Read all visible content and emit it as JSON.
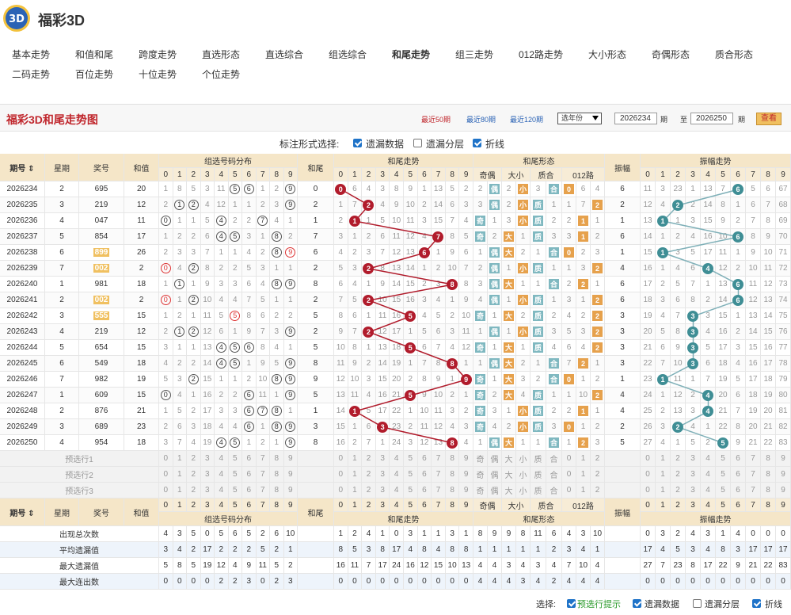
{
  "site": {
    "title": "福彩3D",
    "logo_icon": "fucai-3d-logo"
  },
  "nav": {
    "row1": [
      "基本走势",
      "和值和尾",
      "跨度走势",
      "直选形态",
      "直选综合",
      "组选综合",
      "和尾走势",
      "组三走势",
      "012路走势",
      "大小形态",
      "奇偶形态",
      "质合形态"
    ],
    "row2": [
      "二码走势",
      "百位走势",
      "十位走势",
      "个位走势"
    ],
    "active": "和尾走势"
  },
  "panel": {
    "title": "福彩3D和尾走势图",
    "ranges": [
      "最近50期",
      "最近80期",
      "最近120期"
    ],
    "active_range": "最近50期",
    "year_select": "选年份",
    "from": "2026234",
    "to": "2026250",
    "unit": "期",
    "to_label": "至",
    "query": "查看"
  },
  "markbar": {
    "label": "标注形式选择:",
    "options": [
      {
        "label": "遗漏数据",
        "checked": true
      },
      {
        "label": "遗漏分层",
        "checked": false
      },
      {
        "label": "折线",
        "checked": true
      }
    ]
  },
  "headers": {
    "issue": "期号",
    "week": "星期",
    "prize": "奖号",
    "sum": "和值",
    "tail": "和尾",
    "g_group": "组选号码分布",
    "g_tail": "和尾走势",
    "g_form": "和尾形态",
    "g_amp": "振幅",
    "g_amptrend": "振幅走势",
    "digits": [
      "0",
      "1",
      "2",
      "3",
      "4",
      "5",
      "6",
      "7",
      "8",
      "9"
    ],
    "form_groups": [
      "奇偶",
      "大小",
      "质合",
      "012路"
    ],
    "form_sub": [
      "奇",
      "偶",
      "大",
      "小",
      "质",
      "合",
      "0",
      "1",
      "2"
    ]
  },
  "rows": [
    {
      "issue": "2026234",
      "week": "2",
      "prize": "695",
      "sum": "20",
      "sumhl": false,
      "tail": "0",
      "amp": "6",
      "grp": [
        "1",
        "8",
        "5",
        "3",
        "11",
        "(5)",
        "(6)",
        "1",
        "2",
        "(9)"
      ],
      "tr": [
        "B0",
        "6",
        "4",
        "3",
        "8",
        "9",
        "1",
        "13",
        "5",
        "2"
      ],
      "form": [
        "2",
        "T偶",
        "2",
        "O小",
        "3",
        "T合",
        "O0",
        "6",
        "4"
      ],
      "at": [
        "11",
        "3",
        "23",
        "1",
        "13",
        "7",
        "B6",
        "5",
        "6",
        "67"
      ]
    },
    {
      "issue": "2026235",
      "week": "3",
      "prize": "219",
      "sum": "12",
      "sumhl": false,
      "tail": "2",
      "amp": "2",
      "grp": [
        "2",
        "(1)",
        "(2)",
        "4",
        "12",
        "1",
        "1",
        "2",
        "3",
        "(9)"
      ],
      "tr": [
        "1",
        "7",
        "B2",
        "4",
        "9",
        "10",
        "2",
        "14",
        "6",
        "3"
      ],
      "form": [
        "3",
        "T偶",
        "2",
        "O小",
        "T质",
        "1",
        "1",
        "7",
        "O2"
      ],
      "at": [
        "12",
        "4",
        "B2",
        "2",
        "14",
        "8",
        "1",
        "6",
        "7",
        "68"
      ]
    },
    {
      "issue": "2026236",
      "week": "4",
      "prize": "047",
      "sum": "11",
      "sumhl": false,
      "tail": "1",
      "amp": "1",
      "grp": [
        "(0)",
        "1",
        "1",
        "5",
        "(4)",
        "2",
        "2",
        "(7)",
        "4",
        "1"
      ],
      "tr": [
        "2",
        "B1",
        "1",
        "5",
        "10",
        "11",
        "3",
        "15",
        "7",
        "4"
      ],
      "form": [
        "T奇",
        "1",
        "3",
        "O小",
        "T质",
        "2",
        "2",
        "O1",
        "1"
      ],
      "at": [
        "13",
        "B1",
        "1",
        "3",
        "15",
        "9",
        "2",
        "7",
        "8",
        "69"
      ]
    },
    {
      "issue": "2026237",
      "week": "5",
      "prize": "854",
      "sum": "17",
      "sumhl": false,
      "tail": "7",
      "amp": "6",
      "grp": [
        "1",
        "2",
        "2",
        "6",
        "(4)",
        "(5)",
        "3",
        "1",
        "(8)",
        "2"
      ],
      "tr": [
        "3",
        "1",
        "2",
        "6",
        "11",
        "12",
        "4",
        "B7",
        "8",
        "5"
      ],
      "form": [
        "T奇",
        "2",
        "O大",
        "1",
        "T质",
        "3",
        "3",
        "O1",
        "2"
      ],
      "at": [
        "14",
        "1",
        "2",
        "4",
        "16",
        "10",
        "B6",
        "8",
        "9",
        "70"
      ]
    },
    {
      "issue": "2026238",
      "week": "6",
      "prize": "899",
      "sum": "26",
      "sumhl": true,
      "tail": "6",
      "amp": "1",
      "grp": [
        "2",
        "3",
        "3",
        "7",
        "1",
        "1",
        "4",
        "2",
        "(8)",
        "r9"
      ],
      "tr": [
        "4",
        "2",
        "3",
        "7",
        "12",
        "13",
        "B6",
        "1",
        "9",
        "6"
      ],
      "form": [
        "1",
        "T偶",
        "O大",
        "2",
        "1",
        "T合",
        "O0",
        "2",
        "3"
      ],
      "at": [
        "15",
        "B1",
        "3",
        "5",
        "17",
        "11",
        "1",
        "9",
        "10",
        "71"
      ]
    },
    {
      "issue": "2026239",
      "week": "7",
      "prize": "002",
      "sum": "2",
      "sumhl": true,
      "tail": "2",
      "amp": "4",
      "grp": [
        "r0",
        "4",
        "(2)",
        "8",
        "2",
        "2",
        "5",
        "3",
        "1",
        "1"
      ],
      "tr": [
        "5",
        "3",
        "B2",
        "8",
        "13",
        "14",
        "1",
        "2",
        "10",
        "7"
      ],
      "form": [
        "2",
        "T偶",
        "1",
        "O小",
        "T质",
        "1",
        "1",
        "3",
        "O2"
      ],
      "at": [
        "16",
        "1",
        "4",
        "6",
        "B4",
        "12",
        "2",
        "10",
        "11",
        "72"
      ]
    },
    {
      "issue": "2026240",
      "week": "1",
      "prize": "981",
      "sum": "18",
      "sumhl": false,
      "tail": "8",
      "amp": "6",
      "grp": [
        "1",
        "(1)",
        "1",
        "9",
        "3",
        "3",
        "6",
        "4",
        "(8)",
        "(9)"
      ],
      "tr": [
        "6",
        "4",
        "1",
        "9",
        "14",
        "15",
        "2",
        "3",
        "B8",
        "8"
      ],
      "form": [
        "3",
        "T偶",
        "O大",
        "1",
        "1",
        "T合",
        "2",
        "O2",
        "1"
      ],
      "at": [
        "17",
        "2",
        "5",
        "7",
        "1",
        "13",
        "B6",
        "11",
        "12",
        "73"
      ]
    },
    {
      "issue": "2026241",
      "week": "2",
      "prize": "002",
      "sum": "2",
      "sumhl": true,
      "tail": "2",
      "amp": "6",
      "grp": [
        "r0",
        "1",
        "(2)",
        "10",
        "4",
        "4",
        "7",
        "5",
        "1",
        "1"
      ],
      "tr": [
        "7",
        "5",
        "B2",
        "10",
        "15",
        "16",
        "3",
        "4",
        "1",
        "9"
      ],
      "form": [
        "4",
        "T偶",
        "1",
        "O小",
        "T质",
        "1",
        "3",
        "1",
        "O2"
      ],
      "at": [
        "18",
        "3",
        "6",
        "8",
        "2",
        "14",
        "B6",
        "12",
        "13",
        "74"
      ]
    },
    {
      "issue": "2026242",
      "week": "3",
      "prize": "555",
      "sum": "15",
      "sumhl": true,
      "tail": "5",
      "amp": "3",
      "grp": [
        "1",
        "2",
        "1",
        "11",
        "5",
        "r5",
        "8",
        "6",
        "2",
        "2"
      ],
      "tr": [
        "8",
        "6",
        "1",
        "11",
        "16",
        "B5",
        "4",
        "5",
        "2",
        "10"
      ],
      "form": [
        "T奇",
        "1",
        "O大",
        "2",
        "T质",
        "2",
        "4",
        "2",
        "O2"
      ],
      "at": [
        "19",
        "4",
        "7",
        "B3",
        "3",
        "15",
        "1",
        "13",
        "14",
        "75"
      ]
    },
    {
      "issue": "2026243",
      "week": "4",
      "prize": "219",
      "sum": "12",
      "sumhl": false,
      "tail": "2",
      "amp": "3",
      "grp": [
        "2",
        "(1)",
        "(2)",
        "12",
        "6",
        "1",
        "9",
        "7",
        "3",
        "(9)"
      ],
      "tr": [
        "9",
        "7",
        "B2",
        "12",
        "17",
        "1",
        "5",
        "6",
        "3",
        "11"
      ],
      "form": [
        "1",
        "T偶",
        "1",
        "O小",
        "T质",
        "3",
        "5",
        "3",
        "O2"
      ],
      "at": [
        "20",
        "5",
        "8",
        "B3",
        "4",
        "16",
        "2",
        "14",
        "15",
        "76"
      ]
    },
    {
      "issue": "2026244",
      "week": "5",
      "prize": "654",
      "sum": "15",
      "sumhl": false,
      "tail": "5",
      "amp": "3",
      "grp": [
        "3",
        "1",
        "1",
        "13",
        "(4)",
        "(5)",
        "(6)",
        "8",
        "4",
        "1"
      ],
      "tr": [
        "10",
        "8",
        "1",
        "13",
        "18",
        "B5",
        "6",
        "7",
        "4",
        "12"
      ],
      "form": [
        "T奇",
        "1",
        "O大",
        "1",
        "T质",
        "4",
        "6",
        "4",
        "O2"
      ],
      "at": [
        "21",
        "6",
        "9",
        "B3",
        "5",
        "17",
        "3",
        "15",
        "16",
        "77"
      ]
    },
    {
      "issue": "2026245",
      "week": "6",
      "prize": "549",
      "sum": "18",
      "sumhl": false,
      "tail": "8",
      "amp": "3",
      "grp": [
        "4",
        "2",
        "2",
        "14",
        "(4)",
        "(5)",
        "1",
        "9",
        "5",
        "(9)"
      ],
      "tr": [
        "11",
        "9",
        "2",
        "14",
        "19",
        "1",
        "7",
        "8",
        "B8",
        "1"
      ],
      "form": [
        "1",
        "T偶",
        "O大",
        "2",
        "1",
        "T合",
        "7",
        "O2",
        "1"
      ],
      "at": [
        "22",
        "7",
        "10",
        "B3",
        "6",
        "18",
        "4",
        "16",
        "17",
        "78"
      ]
    },
    {
      "issue": "2026246",
      "week": "7",
      "prize": "982",
      "sum": "19",
      "sumhl": false,
      "tail": "9",
      "amp": "1",
      "grp": [
        "5",
        "3",
        "(2)",
        "15",
        "1",
        "1",
        "2",
        "10",
        "(8)",
        "(9)"
      ],
      "tr": [
        "12",
        "10",
        "3",
        "15",
        "20",
        "2",
        "8",
        "9",
        "1",
        "B9"
      ],
      "form": [
        "T奇",
        "1",
        "O大",
        "3",
        "2",
        "T合",
        "O0",
        "1",
        "2"
      ],
      "at": [
        "23",
        "B1",
        "11",
        "1",
        "7",
        "19",
        "5",
        "17",
        "18",
        "79"
      ]
    },
    {
      "issue": "2026247",
      "week": "1",
      "prize": "609",
      "sum": "15",
      "sumhl": false,
      "tail": "5",
      "amp": "4",
      "grp": [
        "(0)",
        "4",
        "1",
        "16",
        "2",
        "2",
        "(6)",
        "11",
        "1",
        "(9)"
      ],
      "tr": [
        "13",
        "11",
        "4",
        "16",
        "21",
        "B5",
        "9",
        "10",
        "2",
        "1"
      ],
      "form": [
        "T奇",
        "2",
        "O大",
        "4",
        "T质",
        "1",
        "1",
        "10",
        "O2"
      ],
      "at": [
        "24",
        "1",
        "12",
        "2",
        "B4",
        "20",
        "6",
        "18",
        "19",
        "80"
      ]
    },
    {
      "issue": "2026248",
      "week": "2",
      "prize": "876",
      "sum": "21",
      "sumhl": false,
      "tail": "1",
      "amp": "4",
      "grp": [
        "1",
        "5",
        "2",
        "17",
        "3",
        "3",
        "(6)",
        "(7)",
        "(8)",
        "1"
      ],
      "tr": [
        "14",
        "B1",
        "5",
        "17",
        "22",
        "1",
        "10",
        "11",
        "3",
        "2"
      ],
      "form": [
        "T奇",
        "3",
        "1",
        "O小",
        "T质",
        "2",
        "2",
        "O1",
        "1"
      ],
      "at": [
        "25",
        "2",
        "13",
        "3",
        "B4",
        "21",
        "7",
        "19",
        "20",
        "81"
      ]
    },
    {
      "issue": "2026249",
      "week": "3",
      "prize": "689",
      "sum": "23",
      "sumhl": false,
      "tail": "3",
      "amp": "2",
      "grp": [
        "2",
        "6",
        "3",
        "18",
        "4",
        "4",
        "(6)",
        "1",
        "(8)",
        "(9)"
      ],
      "tr": [
        "15",
        "1",
        "6",
        "B3",
        "23",
        "2",
        "11",
        "12",
        "4",
        "3"
      ],
      "form": [
        "T奇",
        "4",
        "2",
        "O小",
        "T质",
        "3",
        "O0",
        "1",
        "2"
      ],
      "at": [
        "26",
        "3",
        "B2",
        "4",
        "1",
        "22",
        "8",
        "20",
        "21",
        "82"
      ]
    },
    {
      "issue": "2026250",
      "week": "4",
      "prize": "954",
      "sum": "18",
      "sumhl": false,
      "tail": "8",
      "amp": "5",
      "grp": [
        "3",
        "7",
        "4",
        "19",
        "(4)",
        "(5)",
        "1",
        "2",
        "1",
        "(9)"
      ],
      "tr": [
        "16",
        "2",
        "7",
        "1",
        "24",
        "3",
        "12",
        "13",
        "B8",
        "4"
      ],
      "form": [
        "1",
        "T偶",
        "O大",
        "1",
        "1",
        "T合",
        "1",
        "O2",
        "3"
      ],
      "at": [
        "27",
        "4",
        "1",
        "5",
        "2",
        "B5",
        "9",
        "21",
        "22",
        "83"
      ]
    }
  ],
  "pre_rows": [
    "预选行1",
    "预选行2",
    "预选行3"
  ],
  "stats": [
    {
      "label": "出现总次数",
      "grp": [
        "4",
        "3",
        "5",
        "0",
        "5",
        "6",
        "5",
        "2",
        "6",
        "10"
      ],
      "tr": [
        "1",
        "2",
        "4",
        "1",
        "0",
        "3",
        "1",
        "1",
        "3",
        "1"
      ],
      "form": [
        "8",
        "9",
        "9",
        "8",
        "11",
        "6",
        "4",
        "3",
        "10"
      ],
      "at": [
        "0",
        "3",
        "2",
        "4",
        "3",
        "1",
        "4",
        "0",
        "0",
        "0"
      ]
    },
    {
      "label": "平均遗漏值",
      "grp": [
        "3",
        "4",
        "2",
        "17",
        "2",
        "2",
        "2",
        "5",
        "2",
        "1"
      ],
      "tr": [
        "8",
        "5",
        "3",
        "8",
        "17",
        "4",
        "8",
        "4",
        "8",
        "8"
      ],
      "form": [
        "1",
        "1",
        "1",
        "1",
        "1",
        "2",
        "3",
        "4",
        "1"
      ],
      "at": [
        "17",
        "4",
        "5",
        "3",
        "4",
        "8",
        "3",
        "17",
        "17",
        "17"
      ]
    },
    {
      "label": "最大遗漏值",
      "grp": [
        "5",
        "8",
        "5",
        "19",
        "12",
        "4",
        "9",
        "11",
        "5",
        "2"
      ],
      "tr": [
        "16",
        "11",
        "7",
        "17",
        "24",
        "16",
        "12",
        "15",
        "10",
        "13"
      ],
      "form": [
        "4",
        "4",
        "3",
        "4",
        "3",
        "4",
        "7",
        "10",
        "4"
      ],
      "at": [
        "27",
        "7",
        "23",
        "8",
        "17",
        "22",
        "9",
        "21",
        "22",
        "83"
      ]
    },
    {
      "label": "最大连出数",
      "grp": [
        "0",
        "0",
        "0",
        "0",
        "2",
        "2",
        "3",
        "0",
        "2",
        "3"
      ],
      "tr": [
        "0",
        "0",
        "0",
        "0",
        "0",
        "0",
        "0",
        "0",
        "0",
        "0"
      ],
      "form": [
        "4",
        "4",
        "4",
        "3",
        "4",
        "2",
        "4",
        "4",
        "4"
      ],
      "at": [
        "0",
        "0",
        "0",
        "0",
        "0",
        "0",
        "0",
        "0",
        "0",
        "0"
      ]
    }
  ],
  "bottombar": {
    "label": "选择:",
    "options": [
      {
        "label": "预选行提示",
        "checked": true,
        "green": true
      },
      {
        "label": "遗漏数据",
        "checked": true
      },
      {
        "label": "遗漏分层",
        "checked": false
      },
      {
        "label": "折线",
        "checked": true
      }
    ]
  },
  "colors": {
    "ball_red": "#b11c2c",
    "ball_teal": "#3f8e95",
    "line_red": "#b11c2c",
    "line_teal": "#7fb0b8",
    "header_bg": "#f5e6c8",
    "highlight": "#f0c060"
  }
}
